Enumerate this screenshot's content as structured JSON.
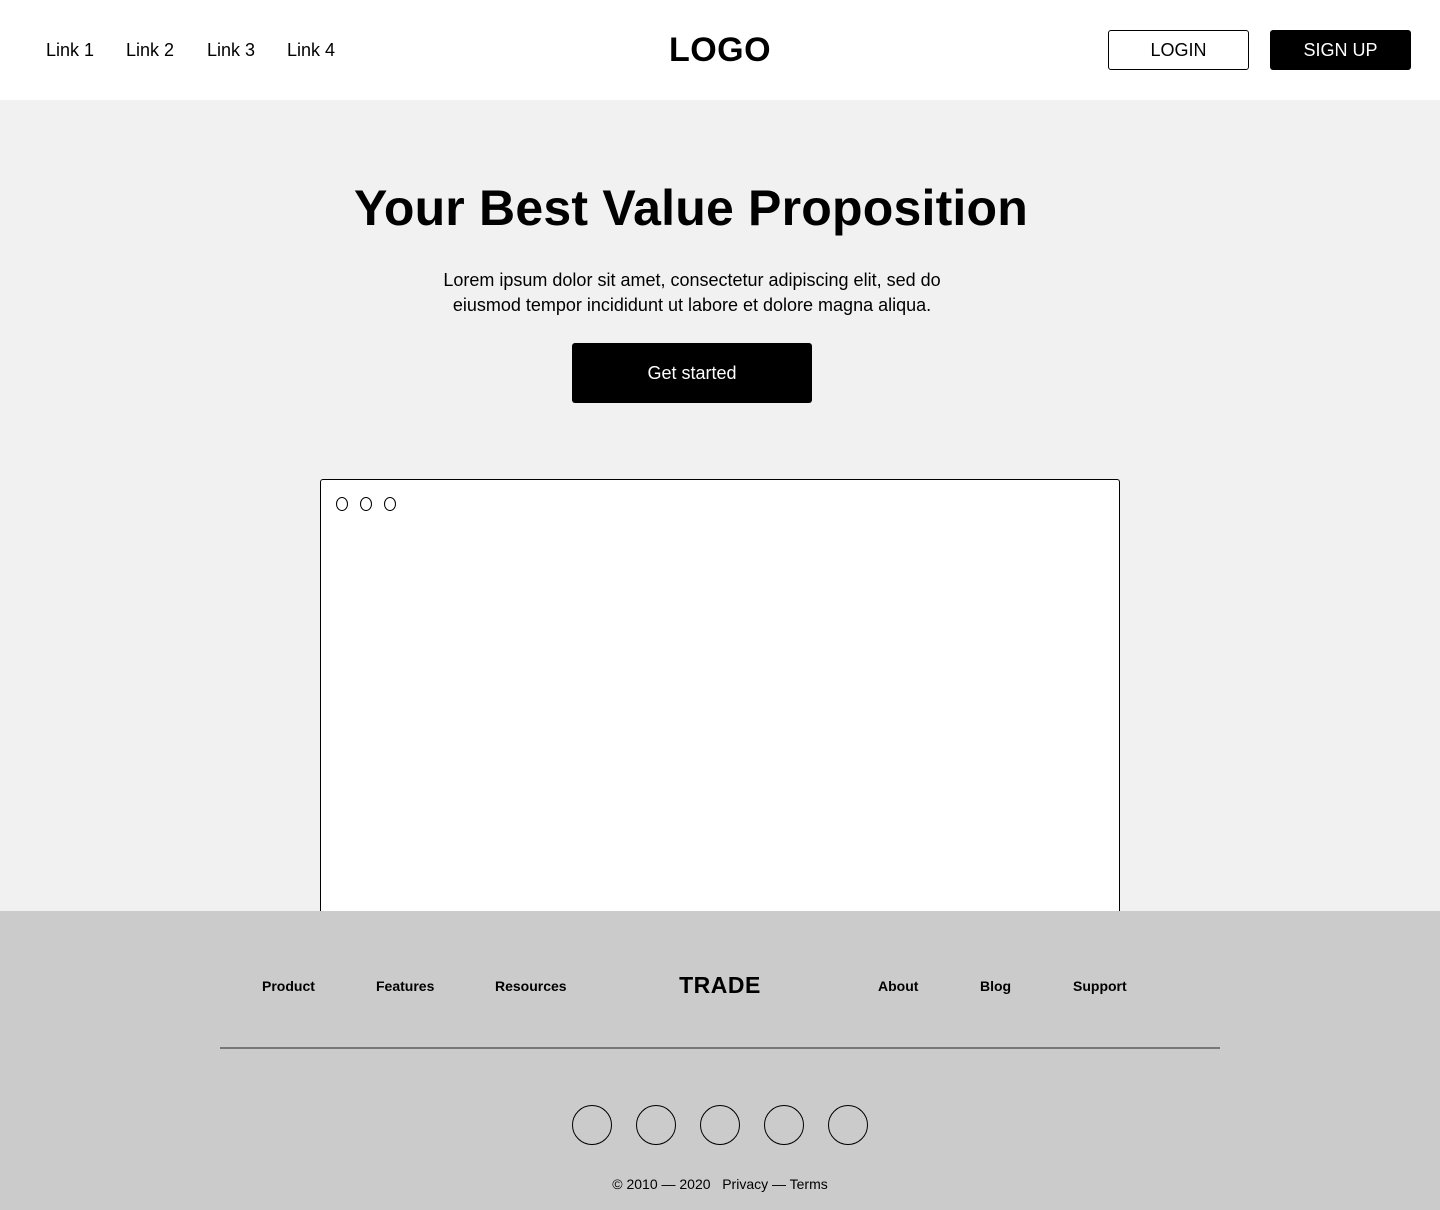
{
  "header": {
    "nav": [
      "Link 1",
      "Link 2",
      "Link 3",
      "Link 4"
    ],
    "logo": "LOGO",
    "login_label": "LOGIN",
    "signup_label": "SIGN UP"
  },
  "hero": {
    "title": "Your Best Value Proposition",
    "text_line1": "Lorem ipsum dolor sit amet, consectetur adipiscing elit, sed do",
    "text_line2": "eiusmod tempor incididunt ut labore et dolore magna aliqua.",
    "cta_label": "Get started"
  },
  "footer": {
    "left_links": [
      "Product",
      "Features",
      "Resources"
    ],
    "logo": "TRADE",
    "right_links": [
      "About",
      "Blog",
      "Support"
    ],
    "copyright": "© 2010 — 2020",
    "legal": "Privacy — Terms"
  },
  "colors": {
    "hero_bg": "#f1f1f1",
    "footer_bg": "#cbcbcb",
    "primary": "#000000"
  }
}
